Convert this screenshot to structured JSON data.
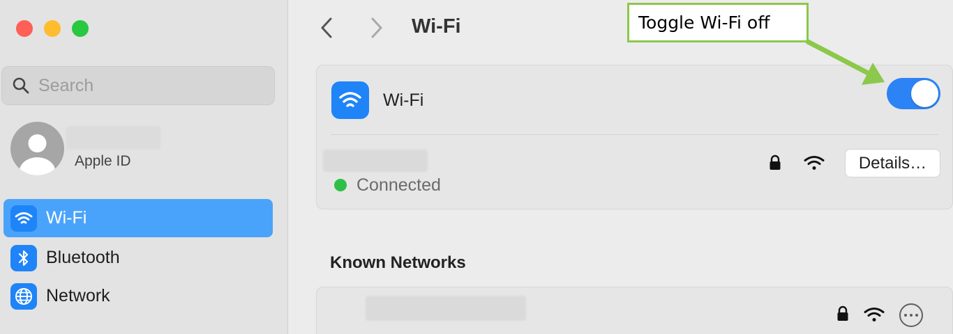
{
  "window": {
    "title": "Wi-Fi"
  },
  "sidebar": {
    "search_placeholder": "Search",
    "account_label": "Apple ID",
    "items": [
      {
        "label": "Wi-Fi",
        "icon": "wifi-icon",
        "active": true
      },
      {
        "label": "Bluetooth",
        "icon": "bluetooth-icon",
        "active": false
      },
      {
        "label": "Network",
        "icon": "globe-icon",
        "active": false
      }
    ]
  },
  "main": {
    "title": "Wi-Fi",
    "wifi": {
      "label": "Wi-Fi",
      "toggle_on": true
    },
    "current_network": {
      "status": "Connected",
      "details_label": "Details…"
    },
    "known_networks_title": "Known Networks"
  },
  "annotation": {
    "text": "Toggle Wi-Fi off",
    "color": "#8cc84b"
  },
  "colors": {
    "accent": "#2b83f6",
    "sidebar_active": "#4aa3fb",
    "connected": "#2dbf48"
  }
}
